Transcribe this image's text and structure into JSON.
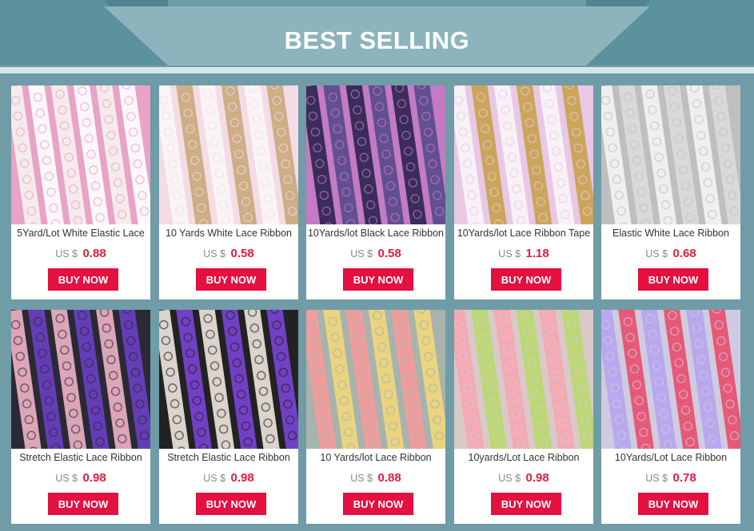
{
  "banner": {
    "title": "BEST SELLING"
  },
  "products": [
    {
      "title": "5Yard/Lot White Elastic Lace",
      "currency": "US $",
      "price": "0.88",
      "button": "BUY NOW",
      "photo": {
        "bg": "#e8a3c7",
        "lace": "#f6f3f0",
        "accent": "#ffffff"
      }
    },
    {
      "title": "10 Yards White Lace Ribbon",
      "currency": "US $",
      "price": "0.58",
      "button": "BUY NOW",
      "photo": {
        "bg": "#f3dce6",
        "lace": "#fbf7f6",
        "accent": "#c9a97a"
      }
    },
    {
      "title": "10Yards/lot Black Lace Ribbon",
      "currency": "US $",
      "price": "0.58",
      "button": "BUY NOW",
      "photo": {
        "bg": "#c47bc3",
        "lace": "#2b2450",
        "accent": "#564a8c"
      }
    },
    {
      "title": "10Yards/lot Lace Ribbon Tape",
      "currency": "US $",
      "price": "1.18",
      "button": "BUY NOW",
      "photo": {
        "bg": "#e9c8e6",
        "lace": "#faf5f7",
        "accent": "#c8a24a"
      }
    },
    {
      "title": "Elastic White Lace Ribbon",
      "currency": "US $",
      "price": "0.68",
      "button": "BUY NOW",
      "photo": {
        "bg": "#bfbfbf",
        "lace": "#f4f4f4",
        "accent": "#dcdcdc"
      }
    },
    {
      "title": "Stretch Elastic Lace Ribbon",
      "currency": "US $",
      "price": "0.98",
      "button": "BUY NOW",
      "photo": {
        "bg": "#2a2a35",
        "lace": "#f0b3c6",
        "accent": "#6a3fc4"
      }
    },
    {
      "title": "Stretch Elastic Lace Ribbon",
      "currency": "US $",
      "price": "0.98",
      "button": "BUY NOW",
      "photo": {
        "bg": "#222",
        "lace": "#efe7df",
        "accent": "#7a44d6"
      }
    },
    {
      "title": "10 Yards/lot Lace Ribbon",
      "currency": "US $",
      "price": "0.88",
      "button": "BUY NOW",
      "photo": {
        "bg": "#a7b3ad",
        "lace": "#f79a9a",
        "accent": "#f2d77a"
      }
    },
    {
      "title": "10yards/Lot Lace Ribbon",
      "currency": "US $",
      "price": "0.98",
      "button": "BUY NOW",
      "photo": {
        "bg": "#d9c9c9",
        "lace": "#f6a6b1",
        "accent": "#b8d96b"
      }
    },
    {
      "title": "10Yards/Lot Lace Ribbon",
      "currency": "US $",
      "price": "0.78",
      "button": "BUY NOW",
      "photo": {
        "bg": "#cfcbe0",
        "lace": "#b5a4f0",
        "accent": "#e84d6c"
      }
    }
  ]
}
